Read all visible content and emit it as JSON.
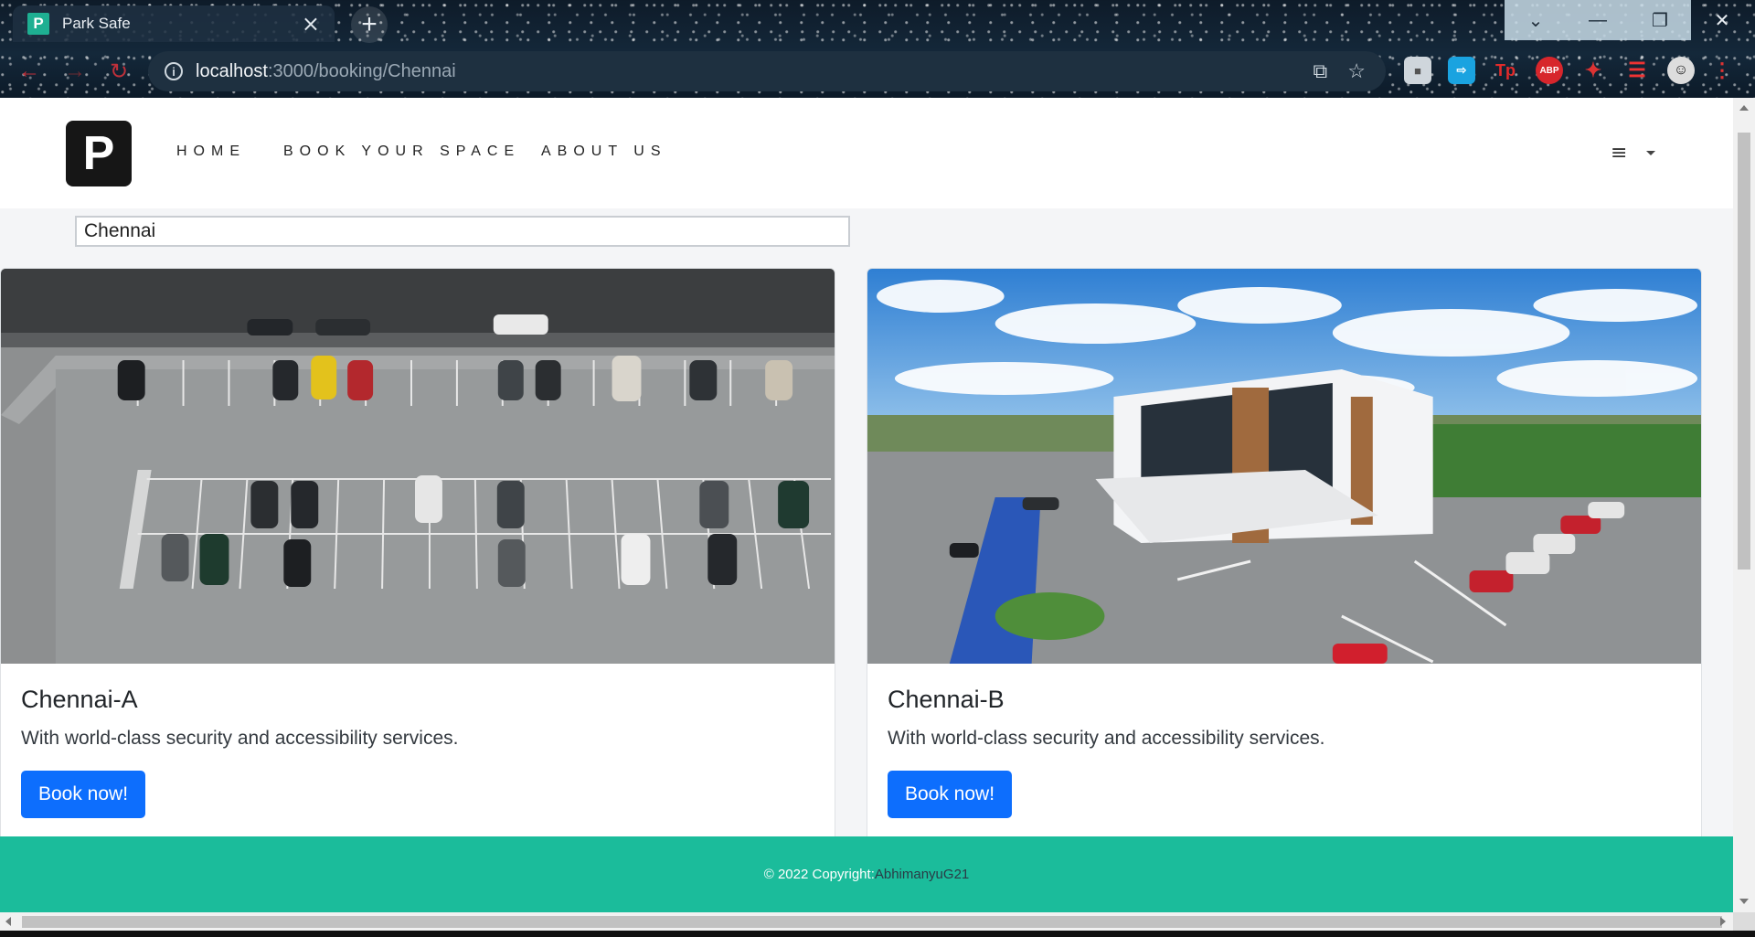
{
  "browser": {
    "tab_title": "Park Safe",
    "tab_favicon_letter": "P",
    "tab_close_icon": "×",
    "new_tab_icon": "+",
    "url_host": "localhost",
    "url_path": ":3000/booking/Chennai",
    "window_controls": {
      "dropdown": "⌄",
      "minimize": "—",
      "restore": "❐",
      "close": "✕"
    },
    "extensions": [
      "box-icon",
      "share-icon",
      "tp-icon",
      "abp-icon",
      "puzzle-icon",
      "playlist-icon",
      "profile-avatar"
    ],
    "abp_label": "ABP",
    "tp_label": "Tp"
  },
  "navbar": {
    "logo_letter": "P",
    "links": [
      "HOME",
      "BOOK YOUR SPACE",
      "ABOUT US"
    ],
    "menu_icon": "≡"
  },
  "search": {
    "value": "Chennai"
  },
  "cards": [
    {
      "title": "Chennai-A",
      "text": "With world-class security and accessibility services.",
      "button": "Book now!",
      "image": "parking-lot-aerial"
    },
    {
      "title": "Chennai-B",
      "text": "With world-class security and accessibility services.",
      "button": "Book now!",
      "image": "building-with-parking-aerial"
    }
  ],
  "footer": {
    "copyright": "© 2022 Copyright:",
    "author": "AbhimanyuG21"
  },
  "colors": {
    "footer_bg": "#1bbc9b",
    "button_bg": "#0d6efd",
    "logo_bg": "#161616"
  }
}
